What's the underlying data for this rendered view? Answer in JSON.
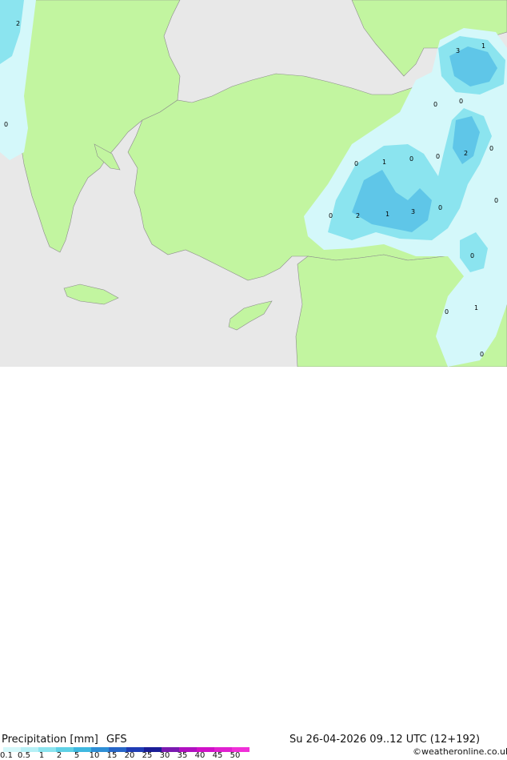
{
  "header": {
    "title": "Precipitation [mm]",
    "model": "GFS",
    "datetime": "Su 26-04-2026 09..12 UTC (12+192)",
    "credit": "©weatheronline.co.uk"
  },
  "legend": {
    "ticks": [
      "0.1",
      "0.5",
      "1",
      "2",
      "5",
      "10",
      "15",
      "20",
      "25",
      "30",
      "35",
      "40",
      "45",
      "50"
    ],
    "colors": [
      "#d4f8fa",
      "#b6f0f6",
      "#8be4ef",
      "#5fd1e6",
      "#3fb8e0",
      "#2f8fd6",
      "#2766c8",
      "#1f3cb4",
      "#1a1d96",
      "#7a1ab0",
      "#b010c0",
      "#d010c8",
      "#e020d0",
      "#f030d8"
    ]
  },
  "colors": {
    "sea": "#e8e8e8",
    "land": "#c2f5a0",
    "light_precip": "#d4f8fa",
    "medium_precip": "#8be4ef",
    "heavy_precip": "#5fc6e8",
    "border": "#8c8c8c"
  },
  "map_labels": [
    "2",
    "3",
    "1",
    "0",
    "0",
    "0",
    "0",
    "1",
    "0",
    "0",
    "2",
    "0",
    "0",
    "0",
    "2",
    "1",
    "3",
    "0",
    "0",
    "0",
    "1",
    "0"
  ]
}
